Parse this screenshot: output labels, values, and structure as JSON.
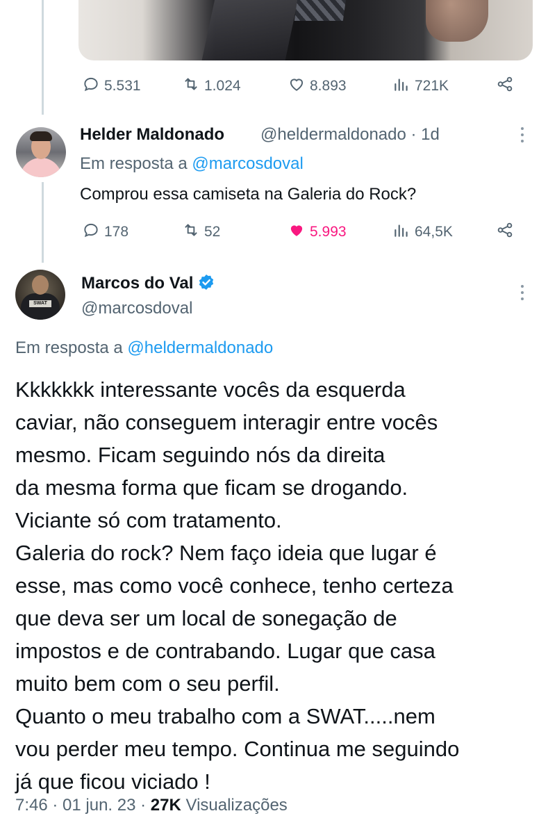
{
  "first_tweet_actions": {
    "replies": "5.531",
    "retweets": "1.024",
    "likes": "8.893",
    "views": "721K"
  },
  "reply_tweet": {
    "name": "Helder Maldonado",
    "handle_time": "@heldermaldonado · 1d",
    "reply_prefix": "Em resposta a ",
    "reply_mention": "@marcosdoval",
    "text": "Comprou essa camiseta na Galeria do Rock?",
    "replies": "178",
    "retweets": "52",
    "likes": "5.993",
    "views": "64,5K"
  },
  "main_tweet": {
    "name": "Marcos do Val",
    "handle": "@marcosdoval",
    "reply_prefix": "Em resposta a ",
    "reply_mention": "@heldermaldonado",
    "text": "Kkkkkkk interessante vocês da esquerda\ncaviar, não conseguem interagir entre vocês\nmesmo. Ficam seguindo nós da direita\nda mesma forma que ficam se drogando.\nViciante só com tratamento.\nGaleria do rock? Nem faço ideia que lugar é\nesse, mas como você conhece, tenho certeza\nque deva ser um local de sonegação de\nimpostos e de contrabando. Lugar que casa\nmuito bem com o seu perfil.\nQuanto o meu trabalho com a SWAT.....nem\nvou perder meu tempo. Continua me seguindo\njá que ficou viciado !",
    "time": "7:46 · 01 jun. 23 · ",
    "views_count": "27K",
    "views_label": " Visualizações"
  },
  "colors": {
    "accent": "#1d9bf0",
    "like": "#f91880",
    "muted": "#536471"
  }
}
